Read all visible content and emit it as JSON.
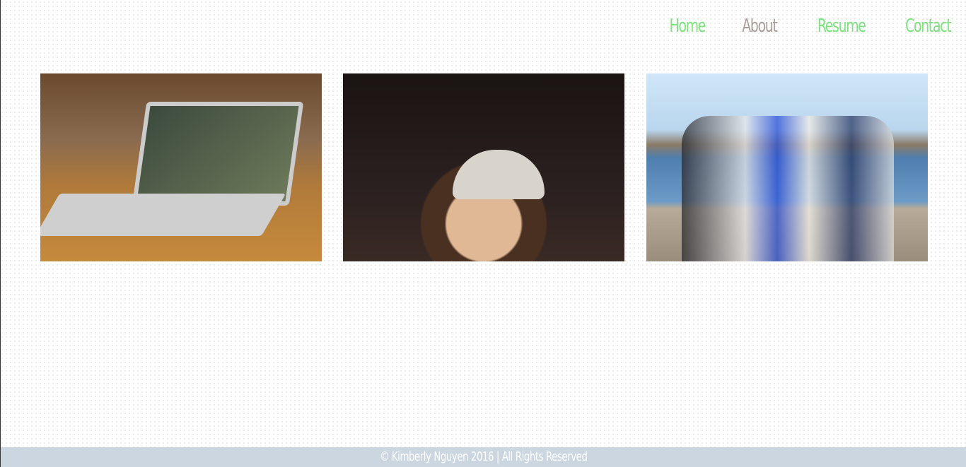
{
  "nav": {
    "items": [
      {
        "label": "Home",
        "color": "#7ee27e"
      },
      {
        "label": "About",
        "color": "#a89e9a"
      },
      {
        "label": "Resume",
        "color": "#7ee27e"
      },
      {
        "label": "Contact",
        "color": "#7ee27e"
      }
    ]
  },
  "gallery": {
    "images": [
      {
        "name": "laptop-photo"
      },
      {
        "name": "portrait-photo"
      },
      {
        "name": "group-photo"
      }
    ]
  },
  "footer": {
    "text": "© Kimberly Nguyen 2016 | All Rights Reserved"
  }
}
